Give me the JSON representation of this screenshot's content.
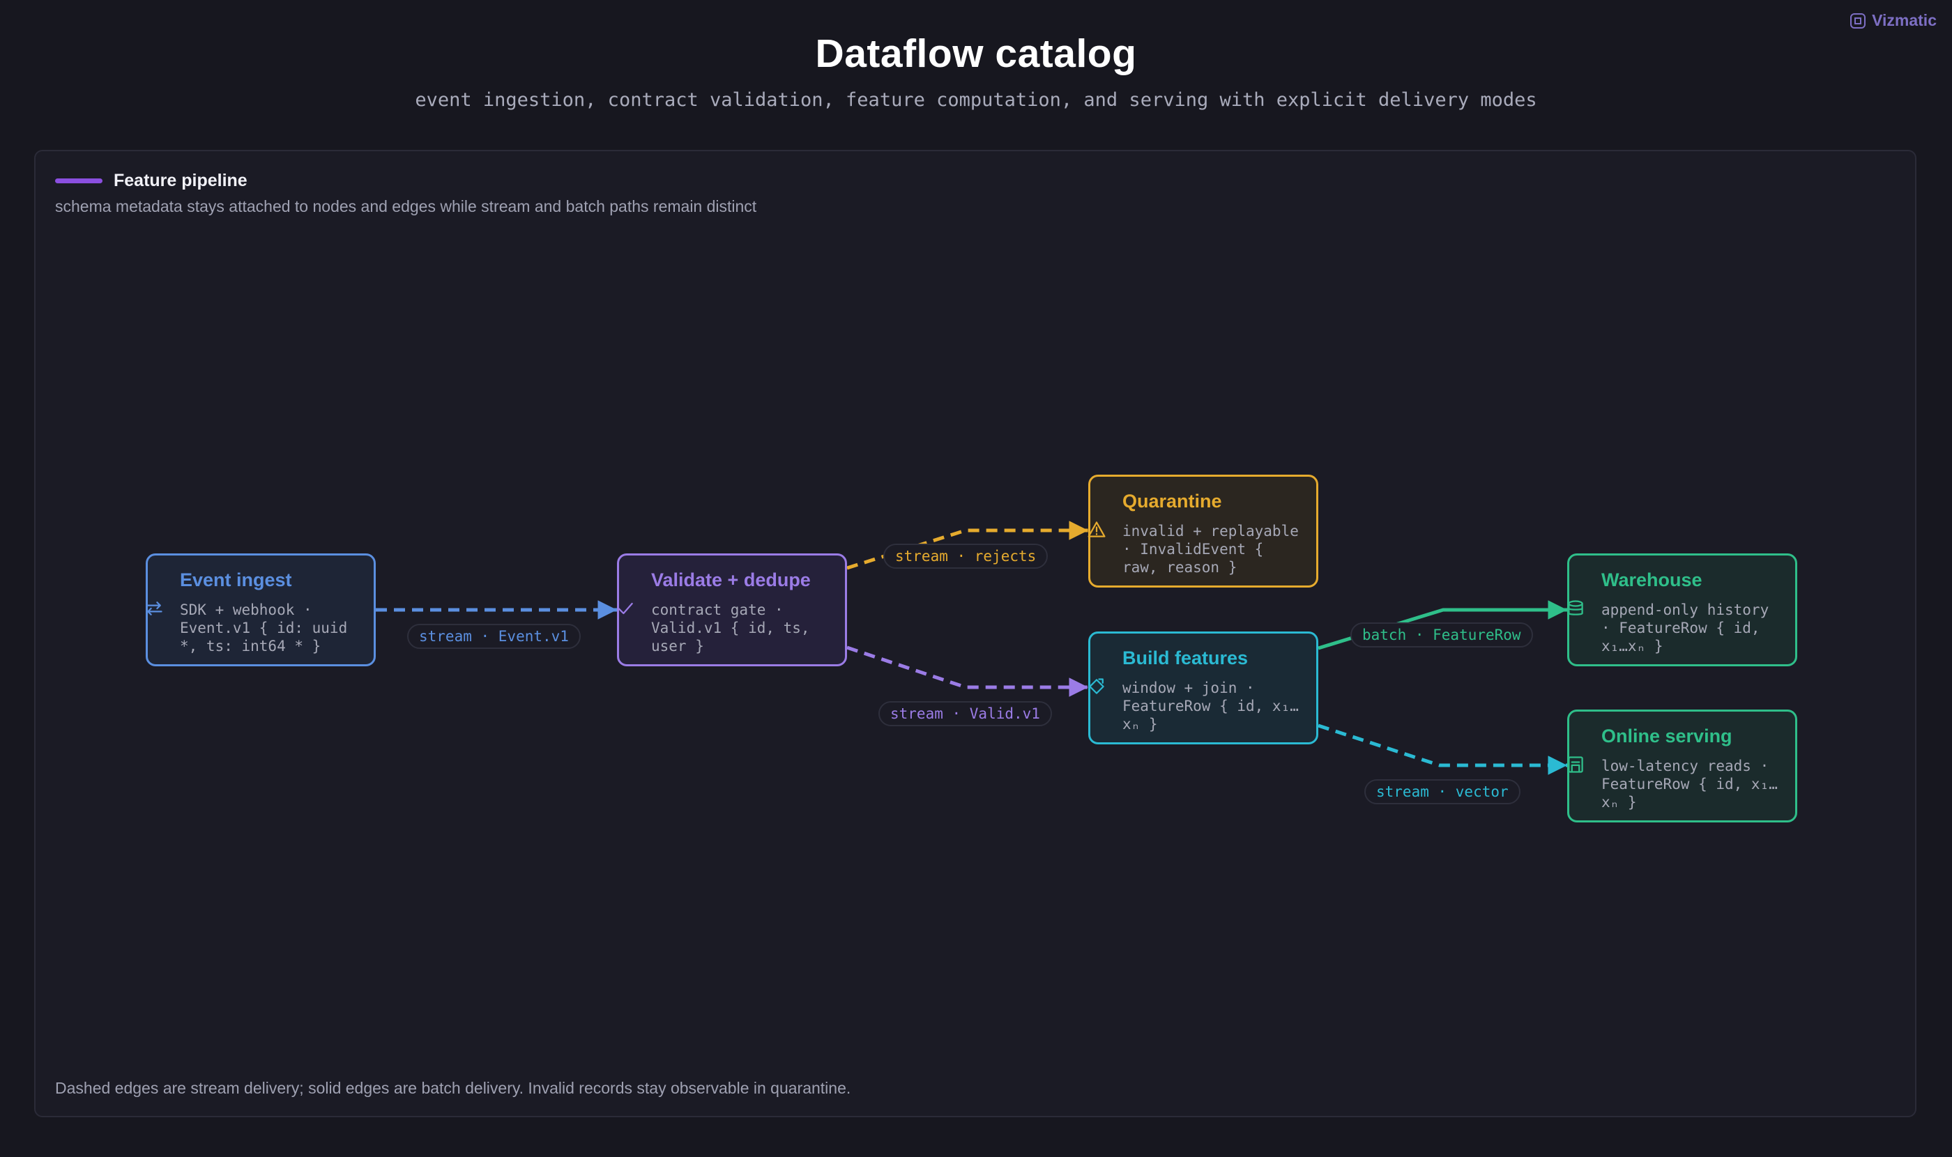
{
  "brand": {
    "name": "Vizmatic",
    "icon": "vizmatic-logo-icon"
  },
  "header": {
    "title": "Dataflow catalog",
    "subtitle": "event ingestion, contract validation, feature computation, and serving with explicit delivery modes"
  },
  "panel": {
    "legend": {
      "label": "Feature pipeline",
      "color": "#8b4fe0"
    },
    "description": "schema metadata stays attached to nodes and edges while stream and batch paths remain distinct",
    "footnote": "Dashed edges are stream delivery; solid edges are batch delivery. Invalid records stay observable in quarantine."
  },
  "nodes": [
    {
      "id": "ingest",
      "title": "Event ingest",
      "desc": "SDK + webhook · Event.v1 { id: uuid *, ts: int64 * }",
      "color": "#5b8fe0",
      "icon": "transfer-arrows-icon"
    },
    {
      "id": "validate",
      "title": "Validate + dedupe",
      "desc": "contract gate · Valid.v1 { id, ts, user }",
      "color": "#9b7ce6",
      "icon": "check-icon"
    },
    {
      "id": "quarantine",
      "title": "Quarantine",
      "desc": "invalid + replayable · InvalidEvent { raw, reason }",
      "color": "#e6ab2e",
      "icon": "warning-icon"
    },
    {
      "id": "features",
      "title": "Build features",
      "desc": "window + join · FeatureRow { id, x₁…xₙ }",
      "color": "#2bbad3",
      "icon": "transform-diamond-icon"
    },
    {
      "id": "warehouse",
      "title": "Warehouse",
      "desc": "append-only history · FeatureRow { id, x₁…xₙ }",
      "color": "#2fbf8a",
      "icon": "database-icon"
    },
    {
      "id": "serving",
      "title": "Online serving",
      "desc": "low-latency reads · FeatureRow { id, x₁…xₙ }",
      "color": "#2fbf8a",
      "icon": "server-icon"
    }
  ],
  "edges": [
    {
      "from": "ingest",
      "to": "validate",
      "mode": "stream",
      "label": "stream · Event.v1",
      "color": "#5b8fe0"
    },
    {
      "from": "validate",
      "to": "quarantine",
      "mode": "stream",
      "label": "stream · rejects",
      "color": "#e6ab2e"
    },
    {
      "from": "validate",
      "to": "features",
      "mode": "stream",
      "label": "stream · Valid.v1",
      "color": "#9b7ce6"
    },
    {
      "from": "features",
      "to": "warehouse",
      "mode": "batch",
      "label": "batch · FeatureRow",
      "color": "#2fbf8a"
    },
    {
      "from": "features",
      "to": "serving",
      "mode": "stream",
      "label": "stream · vector",
      "color": "#2bbad3"
    }
  ]
}
